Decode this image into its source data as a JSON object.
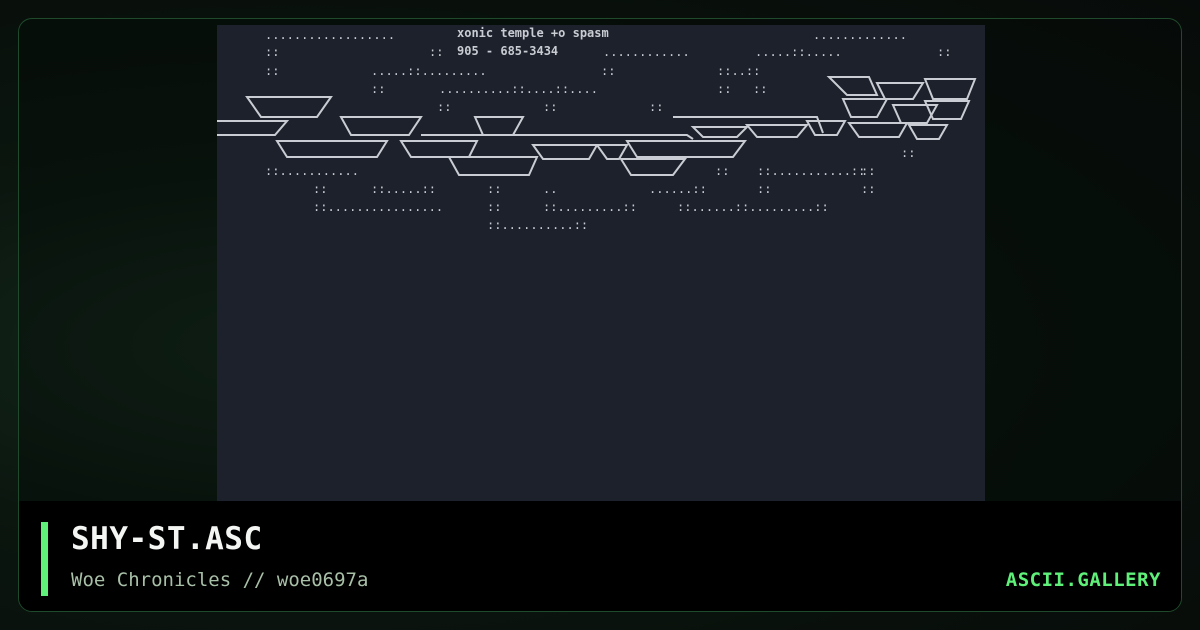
{
  "card": {
    "title": "SHY-ST.ASC",
    "subtitle": "Woe Chronicles // woe0697a",
    "brand": "ASCII.GALLERY"
  },
  "art": {
    "header_line1": "xonic temple +o spasm",
    "header_line2": "905 - 685-3434"
  },
  "colors": {
    "accent": "#5ff07a",
    "panel_background": "#1c212b",
    "art_text": "#c9ccd2"
  }
}
